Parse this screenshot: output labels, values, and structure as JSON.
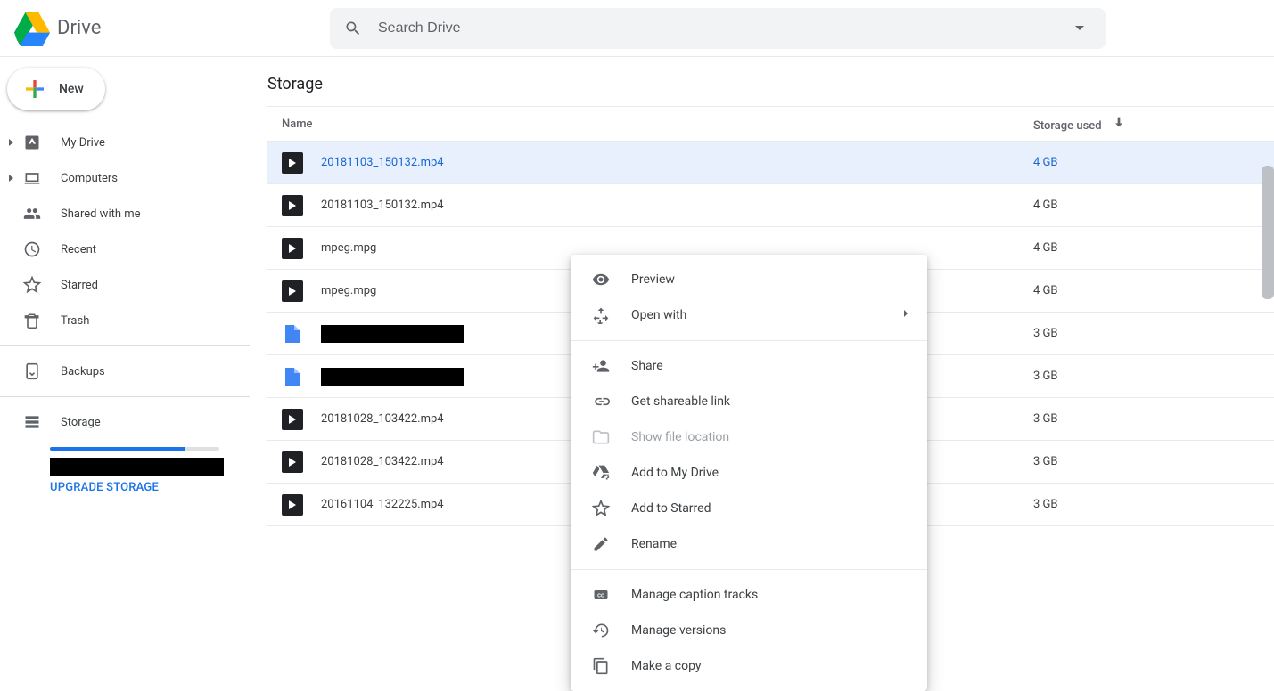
{
  "app": {
    "name": "Drive"
  },
  "search": {
    "placeholder": "Search Drive"
  },
  "new_button": {
    "label": "New"
  },
  "sidebar": {
    "items": [
      {
        "label": "My Drive",
        "expandable": true,
        "icon": "drive"
      },
      {
        "label": "Computers",
        "expandable": true,
        "icon": "computers"
      },
      {
        "label": "Shared with me",
        "expandable": false,
        "icon": "shared"
      },
      {
        "label": "Recent",
        "expandable": false,
        "icon": "recent"
      },
      {
        "label": "Starred",
        "expandable": false,
        "icon": "star"
      },
      {
        "label": "Trash",
        "expandable": false,
        "icon": "trash"
      }
    ],
    "backups": {
      "label": "Backups"
    },
    "storage": {
      "label": "Storage",
      "upgrade": "UPGRADE STORAGE"
    }
  },
  "page": {
    "title": "Storage",
    "columns": {
      "name": "Name",
      "storage_used": "Storage used"
    }
  },
  "files": [
    {
      "name": "20181103_150132.mp4",
      "size": "4 GB",
      "type": "video",
      "selected": true
    },
    {
      "name": "20181103_150132.mp4",
      "size": "4 GB",
      "type": "video"
    },
    {
      "name": "mpeg.mpg",
      "size": "4 GB",
      "type": "video"
    },
    {
      "name": "mpeg.mpg",
      "size": "4 GB",
      "type": "video"
    },
    {
      "name": "",
      "size": "3 GB",
      "type": "doc",
      "redacted": true
    },
    {
      "name": "",
      "size": "3 GB",
      "type": "doc",
      "redacted": true
    },
    {
      "name": "20181028_103422.mp4",
      "size": "3 GB",
      "type": "video"
    },
    {
      "name": "20181028_103422.mp4",
      "size": "3 GB",
      "type": "video"
    },
    {
      "name": "20161104_132225.mp4",
      "size": "3 GB",
      "type": "video"
    }
  ],
  "context_menu": {
    "preview": "Preview",
    "open_with": "Open with",
    "share": "Share",
    "get_link": "Get shareable link",
    "show_location": "Show file location",
    "add_to_drive": "Add to My Drive",
    "add_to_starred": "Add to Starred",
    "rename": "Rename",
    "manage_captions": "Manage caption tracks",
    "manage_versions": "Manage versions",
    "make_copy": "Make a copy"
  }
}
